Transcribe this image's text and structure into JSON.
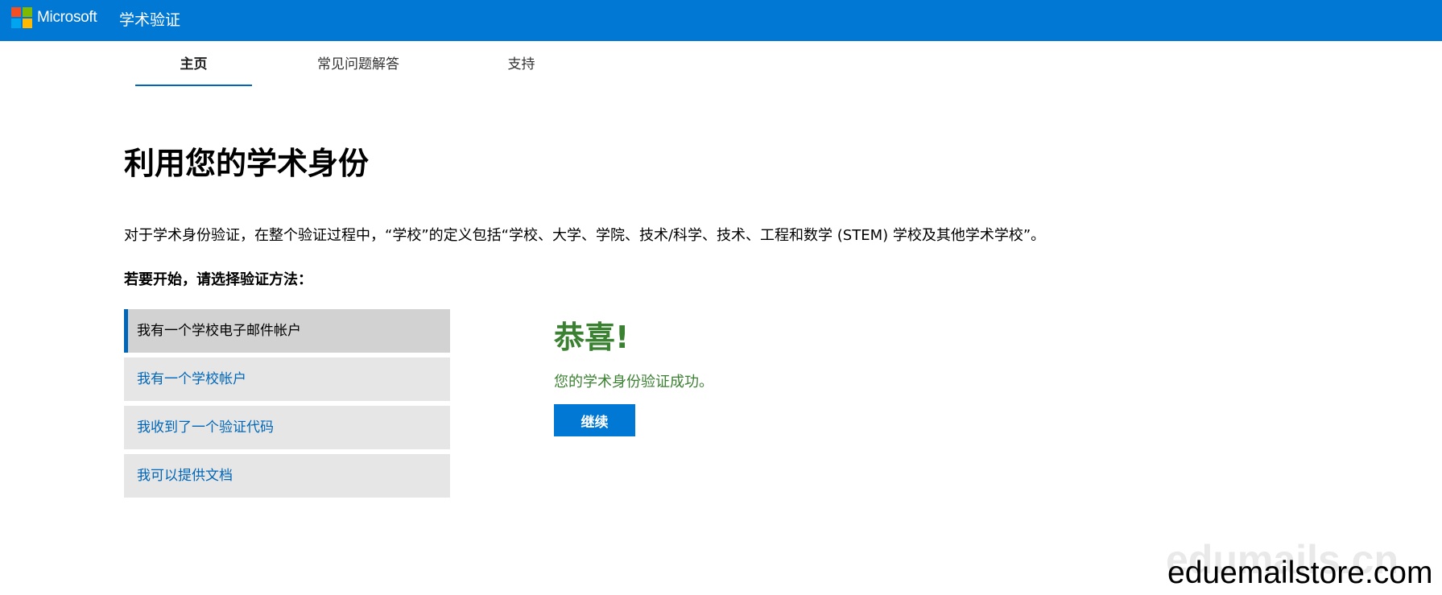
{
  "header": {
    "brand": "Microsoft",
    "product": "学术验证",
    "logo_colors": [
      "#f25022",
      "#7fba00",
      "#00a4ef",
      "#ffb900"
    ],
    "background": "#0078d4"
  },
  "tabs": [
    {
      "label": "主页",
      "active": true
    },
    {
      "label": "常见问题解答",
      "active": false
    },
    {
      "label": "支持",
      "active": false
    }
  ],
  "main": {
    "title": "利用您的学术身份",
    "intro": "对于学术身份验证，在整个验证过程中，“学校”的定义包括“学校、大学、学院、技术/科学、技术、工程和数学 (STEM) 学校及其他学术学校”。",
    "prompt": "若要开始，请选择验证方法："
  },
  "methods": [
    {
      "label": "我有一个学校电子邮件帐户",
      "selected": true
    },
    {
      "label": "我有一个学校帐户",
      "selected": false
    },
    {
      "label": "我收到了一个验证代码",
      "selected": false
    },
    {
      "label": "我可以提供文档",
      "selected": false
    }
  ],
  "success": {
    "title": "恭喜!",
    "message": "您的学术身份验证成功。",
    "button": "继续",
    "color": "#3b8132"
  },
  "watermarks": {
    "faint": "edumails.cn",
    "main": "eduemailstore.com"
  },
  "accent_color": "#0067b8"
}
